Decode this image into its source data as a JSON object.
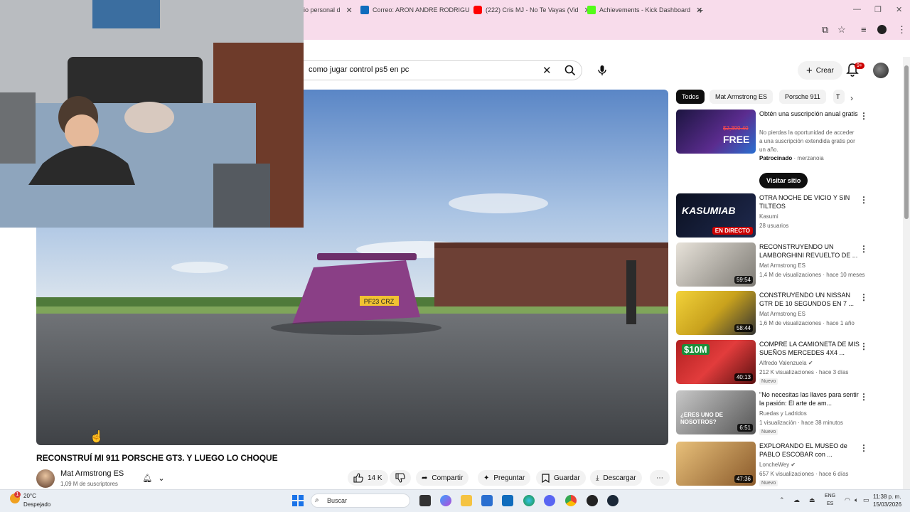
{
  "browser": {
    "tabs": [
      {
        "title": "io personal d",
        "color": "#888888"
      },
      {
        "title": "Correo: ARON ANDRE RODRIGU",
        "color": "#0f6cbd"
      },
      {
        "title": "(222) Cris MJ - No Te Vayas (Vid",
        "color": "#ff0000"
      },
      {
        "title": "Achievements - Kick Dashboard",
        "color": "#53fc18"
      }
    ],
    "new_tab": "+"
  },
  "youtube": {
    "search": {
      "value": "como jugar control ps5 en pc"
    },
    "create_label": "Crear",
    "notif_count": "9+"
  },
  "video": {
    "title": "RECONSTRUÍ MI 911 PORSCHE GT3. Y LUEGO LO CHOQUE",
    "channel": "Mat Armstrong ES",
    "subscribers": "1,09 M de suscriptores",
    "plate": "PF23 CRZ",
    "actions": {
      "likes": "14 K",
      "share": "Compartir",
      "ask": "Preguntar",
      "save": "Guardar",
      "download": "Descargar"
    }
  },
  "chips": [
    "Todos",
    "Mat Armstrong ES",
    "Porsche 911",
    "T"
  ],
  "ad": {
    "title": "Obtén una suscripción anual gratis",
    "description": "No pierdas la oportunidad de acceder a una suscripción extendida gratis por un año.",
    "sponsored": "Patrocinado",
    "advertiser": "merzanoia",
    "cta": "Visitar sitio",
    "thumb_text": "FREE",
    "thumb_price": "$2,399.40"
  },
  "recommendations": [
    {
      "title": "OTRA NOCHE DE VICIO Y SIN TILTEOS",
      "channel": "Kasumi",
      "meta": "28 usuarios",
      "thumb_text": "KASUMIAB",
      "live": "EN DIRECTO",
      "duration": "",
      "badge": ""
    },
    {
      "title": "RECONSTRUYENDO UN LAMBORGHINI REVUELTO DE ...",
      "channel": "Mat Armstrong ES",
      "meta": "1,4 M de visualizaciones · hace 10 meses",
      "duration": "59:54",
      "badge": ""
    },
    {
      "title": "CONSTRUYENDO UN NISSAN GTR DE 10 SEGUNDOS EN 7 ...",
      "channel": "Mat Armstrong ES",
      "meta": "1,6 M de visualizaciones · hace 1 año",
      "duration": "58:44",
      "badge": ""
    },
    {
      "title": "COMPRE LA CAMIONETA DE MIS SUEÑOS MERCEDES 4X4 ...",
      "channel": "Alfredo Valenzuela",
      "meta": "212 K visualizaciones · hace 3 días",
      "duration": "40:13",
      "badge": "Nuevo",
      "thumb_text": "$10M"
    },
    {
      "title": "\"No necesitas las llaves para sentir la pasión: El arte de am...",
      "channel": "Ruedas y Ladridos",
      "meta": "1 visualización · hace 38 minutos",
      "duration": "6:51",
      "badge": "Nuevo",
      "thumb_text": "¿ERES UNO DE NOSOTROS?"
    },
    {
      "title": "EXPLORANDO EL MUSEO de PABLO ESCOBAR con ...",
      "channel": "LoncheWey",
      "meta": "657 K visualizaciones · hace 6 días",
      "duration": "47:36",
      "badge": "Nuevo"
    }
  ],
  "taskbar": {
    "weather_badge": "1",
    "temp": "20°C",
    "condition": "Despejado",
    "search": "Buscar",
    "lang1": "ENG",
    "lang2": "ES",
    "time": "11:38 p. m.",
    "date": "15/03/2026"
  },
  "colors": {
    "accent_red": "#cc0000",
    "chrome_pink": "#f8dceb",
    "car_purple": "#8a3f86"
  }
}
